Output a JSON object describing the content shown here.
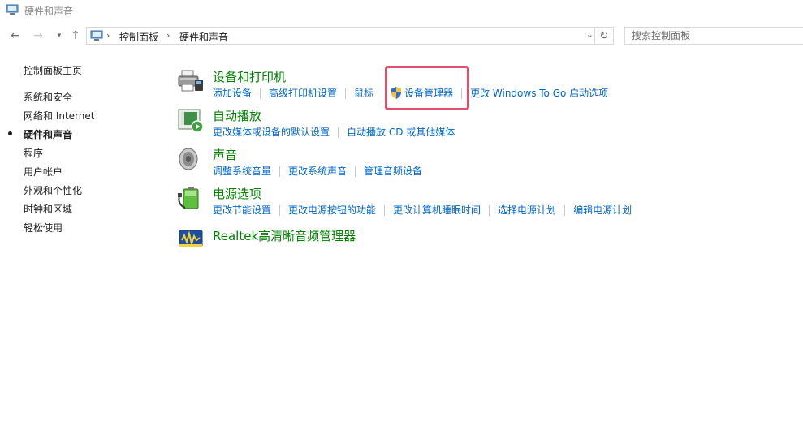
{
  "window": {
    "title": "硬件和声音"
  },
  "address": {
    "breadcrumbs": [
      "控制面板",
      "硬件和声音"
    ]
  },
  "search": {
    "placeholder": "搜索控制面板"
  },
  "sidebar": {
    "items": [
      {
        "label": "控制面板主页",
        "active": false
      },
      {
        "label": "系统和安全",
        "active": false
      },
      {
        "label": "网络和 Internet",
        "active": false
      },
      {
        "label": "硬件和声音",
        "active": true
      },
      {
        "label": "程序",
        "active": false
      },
      {
        "label": "用户帐户",
        "active": false
      },
      {
        "label": "外观和个性化",
        "active": false
      },
      {
        "label": "时钟和区域",
        "active": false
      },
      {
        "label": "轻松使用",
        "active": false
      }
    ]
  },
  "categories": [
    {
      "title": "设备和打印机",
      "icon": "printer-icon",
      "links": [
        "添加设备",
        "高级打印机设置",
        "鼠标",
        "设备管理器",
        "更改 Windows To Go 启动选项"
      ]
    },
    {
      "title": "自动播放",
      "icon": "autoplay-icon",
      "links": [
        "更改媒体或设备的默认设置",
        "自动播放 CD 或其他媒体"
      ]
    },
    {
      "title": "声音",
      "icon": "speaker-icon",
      "links": [
        "调整系统音量",
        "更改系统声音",
        "管理音频设备"
      ]
    },
    {
      "title": "电源选项",
      "icon": "battery-icon",
      "links": [
        "更改节能设置",
        "更改电源按钮的功能",
        "更改计算机睡眠时间",
        "选择电源计划",
        "编辑电源计划"
      ]
    },
    {
      "title": "Realtek高清晰音频管理器",
      "icon": "realtek-audio-icon",
      "links": []
    }
  ],
  "colors": {
    "category_title": "#008000",
    "link": "#0066cc",
    "highlight_box": "#e0526b"
  }
}
